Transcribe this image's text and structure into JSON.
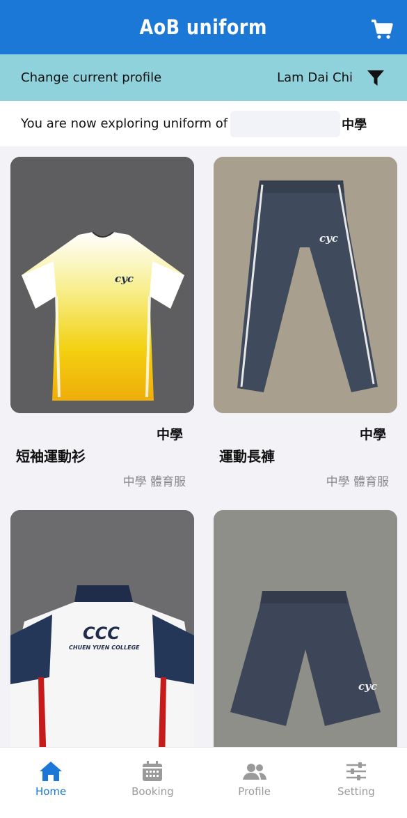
{
  "app_bar": {
    "title": "AoB uniform",
    "cart_icon": "cart-icon"
  },
  "profile_bar": {
    "change_label": "Change current profile",
    "profile_name": "Lam Dai Chi",
    "filter_icon": "filter-icon"
  },
  "explore_bar": {
    "prefix": "You are now exploring uniform of",
    "school_suffix": "中學"
  },
  "products": [
    {
      "school": "中學",
      "name": "短袖運動衫",
      "category": "中學 體育服"
    },
    {
      "school": "中學",
      "name": "運動長褲",
      "category": "中學 體育服"
    },
    {
      "school": "",
      "name": "",
      "category": ""
    },
    {
      "school": "",
      "name": "",
      "category": ""
    }
  ],
  "bottom_nav": [
    {
      "label": "Home",
      "icon": "home-icon",
      "active": true
    },
    {
      "label": "Booking",
      "icon": "calendar-icon",
      "active": false
    },
    {
      "label": "Profile",
      "icon": "users-icon",
      "active": false
    },
    {
      "label": "Setting",
      "icon": "sliders-icon",
      "active": false
    }
  ],
  "colors": {
    "primary": "#1b78d6",
    "profile_bar": "#8fd2dc",
    "background": "#f2f2f7"
  }
}
